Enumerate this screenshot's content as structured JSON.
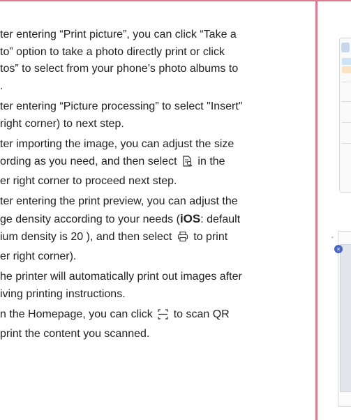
{
  "steps": [
    {
      "lines": [
        "ter entering “Print picture”, you can click “Take a",
        "to” option to take a photo directly print or click",
        "tos” to select from your phone’s photo albums to",
        "."
      ]
    },
    {
      "lines": [
        "ter entering “Picture processing” to select \"Insert\"",
        "right corner) to next step."
      ]
    },
    {
      "lines": [
        "ter importing the image, you can adjust the size",
        "ording as you need, and then select",
        "in the",
        "er right corner to proceed next step."
      ]
    },
    {
      "lines": [
        "ter entering the print preview, you can adjust the",
        "ge density according to your needs (",
        "iOS",
        ": default",
        "ium density is 20 ), and then select",
        "to print",
        "er right corner)."
      ]
    },
    {
      "lines": [
        "he printer will automatically print out images after",
        "iving printing instructions."
      ]
    },
    {
      "lines": [
        "n the Homepage, you can click",
        "to scan QR",
        "print the content you scanned."
      ]
    }
  ],
  "icons": {
    "confirm": "document-check-icon",
    "print": "printer-icon",
    "scan": "qr-scan-icon"
  },
  "colors": {
    "accent_border": "#e07a8c",
    "ios_badge": "#4b67c7"
  },
  "right_panel": {
    "badge_glyph": "×",
    "back_glyph": "<"
  }
}
